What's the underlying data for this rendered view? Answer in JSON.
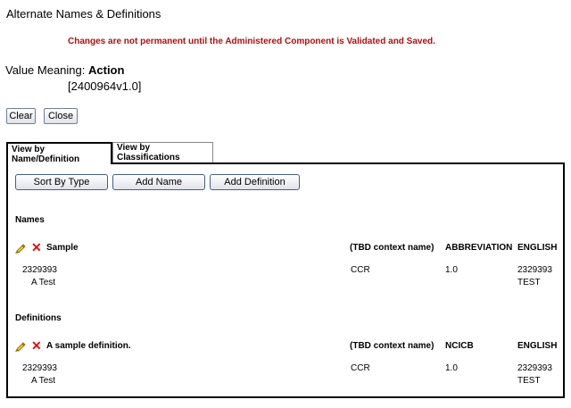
{
  "page": {
    "title": "Alternate Names & Definitions",
    "warning": "Changes are not permanent until the Administered Component is Validated and Saved.",
    "value_meaning_label": "Value Meaning:",
    "value_meaning_name": "Action",
    "value_meaning_id": "[2400964v1.0]"
  },
  "buttons": {
    "clear": "Clear",
    "close": "Close"
  },
  "tabs": [
    {
      "label": "View by Name/Definition",
      "active": true
    },
    {
      "label": "View by Classifications",
      "active": false
    }
  ],
  "panel_buttons": {
    "sort": "Sort By Type",
    "add_name": "Add Name",
    "add_definition": "Add Definition"
  },
  "names": {
    "heading": "Names",
    "row": {
      "name": "Sample",
      "context": "(TBD context name)",
      "type": "ABBREVIATION",
      "language": "ENGLISH",
      "sub_id": "2329393",
      "sub_desc": "A Test",
      "sub_context": "CCR",
      "sub_version": "1.0",
      "sub_id2": "2329393",
      "sub_desc2": "TEST"
    }
  },
  "definitions": {
    "heading": "Definitions",
    "row": {
      "name": "A sample definition.",
      "context": "(TBD context name)",
      "type": "NCICB",
      "language": "ENGLISH",
      "sub_id": "2329393",
      "sub_desc": "A Test",
      "sub_context": "CCR",
      "sub_version": "1.0",
      "sub_id2": "2329393",
      "sub_desc2": "TEST"
    }
  },
  "icons": {
    "edit": "pencil-icon",
    "delete": "red-x-icon"
  },
  "colors": {
    "warning": "#b01010",
    "delete": "#e01010"
  }
}
